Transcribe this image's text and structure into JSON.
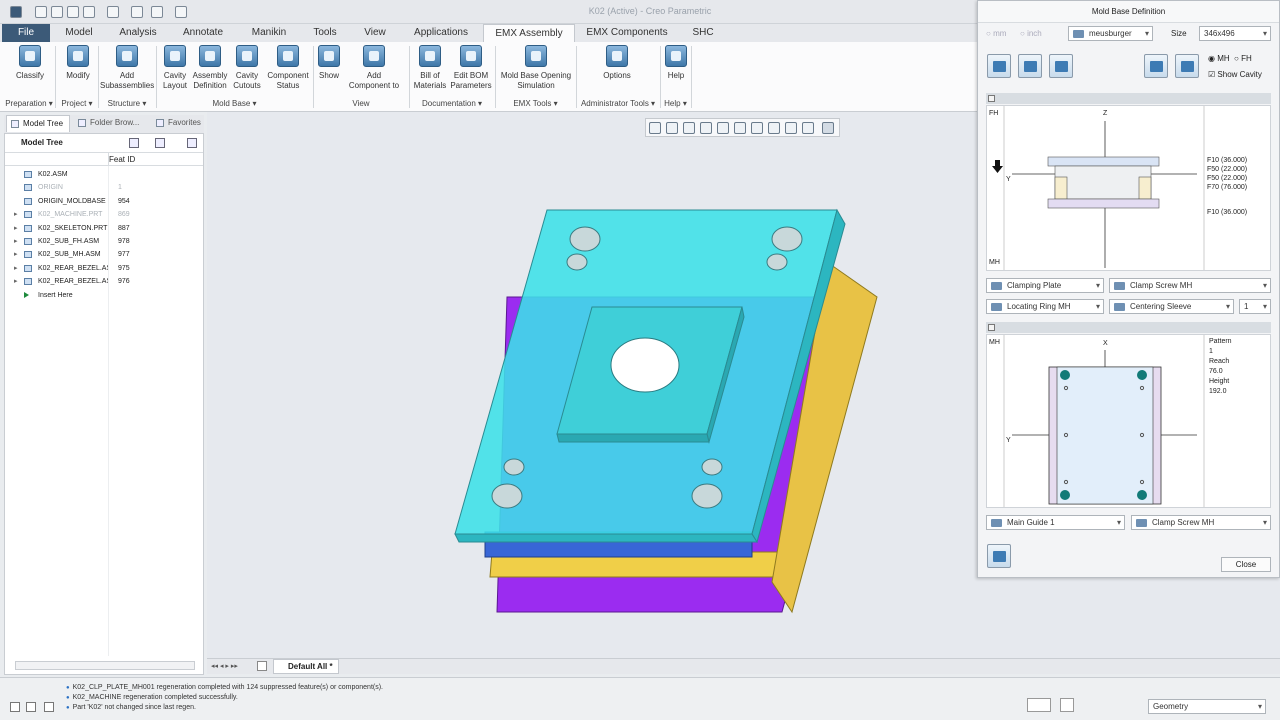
{
  "window": {
    "title": "K02 (Active) - Creo Parametric"
  },
  "tabs": [
    "File",
    "Model",
    "Analysis",
    "Annotate",
    "Manikin",
    "Tools",
    "View",
    "Applications",
    "EMX Assembly",
    "EMX Components",
    "SHC"
  ],
  "ribbon": {
    "buttons": [
      {
        "label": "Classify",
        "icon": "classify-icon"
      },
      {
        "label": "Modify",
        "icon": "modify-icon"
      },
      {
        "label": "Add\nSubassemblies",
        "icon": "add-subassemblies-icon"
      },
      {
        "label": "Cavity\nLayout",
        "icon": "cavity-layout-icon"
      },
      {
        "label": "Assembly\nDefinition",
        "icon": "assembly-definition-icon"
      },
      {
        "label": "Cavity\nCutouts",
        "icon": "cavity-cutouts-icon"
      },
      {
        "label": "Component\nStatus",
        "icon": "component-status-icon"
      },
      {
        "label": "Show",
        "icon": "show-icon"
      },
      {
        "label": "Add\nComponent to",
        "icon": "add-component-icon"
      },
      {
        "label": "Bill of\nMaterials",
        "icon": "bill-of-materials-icon"
      },
      {
        "label": "Edit BOM\nParameters",
        "icon": "edit-bom-icon"
      },
      {
        "label": "Mold Base Opening\nSimulation",
        "icon": "simulation-icon"
      },
      {
        "label": "Options",
        "icon": "options-icon"
      },
      {
        "label": "Help",
        "icon": "help-icon"
      }
    ],
    "groups": [
      "Preparation ▾",
      "Project ▾",
      "Structure ▾",
      "Mold Base ▾",
      "View",
      "Documentation ▾",
      "EMX Tools ▾",
      "Administrator Tools ▾",
      "Help ▾"
    ]
  },
  "left_tabs": [
    "Model Tree",
    "Folder Brow...",
    "Favorites"
  ],
  "tree": {
    "header": "Model Tree",
    "col": "Feat ID",
    "rows": [
      {
        "name": "K02.ASM",
        "id": "",
        "grey": false,
        "exp": ""
      },
      {
        "name": "ORIGIN",
        "id": "1",
        "grey": true,
        "exp": ""
      },
      {
        "name": "ORIGIN_MOLDBASE",
        "id": "954",
        "grey": false,
        "exp": ""
      },
      {
        "name": "K02_MACHINE.PRT",
        "id": "869",
        "grey": true,
        "exp": "▸"
      },
      {
        "name": "K02_SKELETON.PRT",
        "id": "887",
        "grey": false,
        "exp": "▸"
      },
      {
        "name": "K02_SUB_FH.ASM",
        "id": "978",
        "grey": false,
        "exp": "▸"
      },
      {
        "name": "K02_SUB_MH.ASM",
        "id": "977",
        "grey": false,
        "exp": "▸"
      },
      {
        "name": "K02_REAR_BEZEL.AS",
        "id": "975",
        "grey": false,
        "exp": "▸"
      },
      {
        "name": "K02_REAR_BEZEL.AS",
        "id": "976",
        "grey": false,
        "exp": "▸"
      },
      {
        "name": "Insert Here",
        "id": "",
        "grey": false,
        "exp": ""
      }
    ]
  },
  "view_tab": "Default All *",
  "status": [
    "K02_CLP_PLATE_MH001 regeneration completed with 124 suppressed feature(s) or component(s).",
    "K02_MACHINE regeneration completed successfully.",
    "Part 'K02' not changed since last regen."
  ],
  "filter": "Geometry",
  "dialog": {
    "title": "Mold Base Definition",
    "units": [
      "mm",
      "inch"
    ],
    "vendor": "meusburger",
    "size_label": "Size",
    "size": "346x496",
    "side_options": [
      "MH",
      "FH"
    ],
    "show_cavity": "Show Cavity",
    "top_sketch": {
      "fh": "FH",
      "mh": "MH",
      "z": "Z",
      "y": "Y",
      "labels": [
        "F10 (36.000)",
        "F50 (22.000)",
        "F50 (22.000)",
        "F70 (76.000)",
        "F10 (36.000)"
      ]
    },
    "dd1": [
      "Clamping Plate",
      "Clamp Screw MH"
    ],
    "dd2": [
      "Locating Ring MH",
      "Centering Sleeve",
      "1"
    ],
    "bottom_sketch": {
      "mh": "MH",
      "x": "X",
      "y": "Y",
      "info": [
        "Pattern",
        "1",
        "Reach",
        "76.0",
        "Height",
        "192.0"
      ]
    },
    "dd3": [
      "Main Guide 1",
      "Clamp Screw MH"
    ],
    "close": "Close"
  }
}
